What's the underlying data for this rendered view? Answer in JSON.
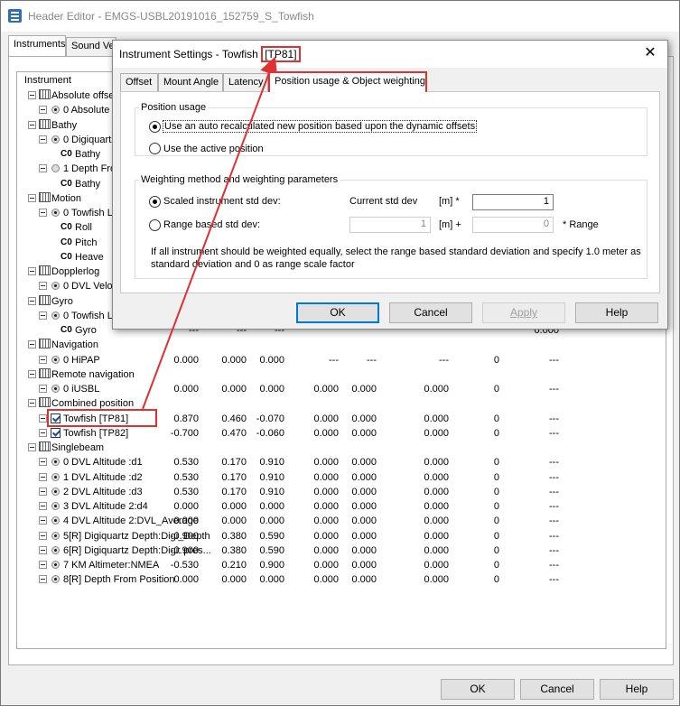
{
  "window": {
    "title": "Header Editor - EMGS-USBL20191016_152759_S_Towfish",
    "tabs": [
      "Instruments",
      "Sound Ve"
    ]
  },
  "tree": {
    "column_header": "Instrument",
    "rows": [
      {
        "label": "Absolute offse",
        "kind": "group"
      },
      {
        "label": "0 Absolute",
        "kind": "radio",
        "cells": []
      },
      {
        "label": "Bathy",
        "kind": "group"
      },
      {
        "label": "0 Digiquartz",
        "kind": "radio",
        "cells": []
      },
      {
        "label": "Bathy",
        "kind": "sensor"
      },
      {
        "label": "1 Depth Fro",
        "kind": "radio_off",
        "cells": []
      },
      {
        "label": "Bathy",
        "kind": "sensor"
      },
      {
        "label": "Motion",
        "kind": "group"
      },
      {
        "label": "0 Towfish Le",
        "kind": "radio",
        "cells": []
      },
      {
        "label": "Roll",
        "kind": "sensor"
      },
      {
        "label": "Pitch",
        "kind": "sensor"
      },
      {
        "label": "Heave",
        "kind": "sensor"
      },
      {
        "label": "Dopplerlog",
        "kind": "group"
      },
      {
        "label": "0 DVL Velo",
        "kind": "radio",
        "cells": []
      },
      {
        "label": "Gyro",
        "kind": "group"
      },
      {
        "label": "0 Towfish Le",
        "kind": "radio",
        "cells": []
      },
      {
        "label": "Gyro",
        "kind": "sensor",
        "cells": [
          "---",
          "---",
          "---",
          "",
          "",
          "",
          "",
          "0.000"
        ]
      },
      {
        "label": "Navigation",
        "kind": "group"
      },
      {
        "label": "0 HiPAP",
        "kind": "radio",
        "cells": [
          "0.000",
          "0.000",
          "0.000",
          "---",
          "---",
          "---",
          "0",
          "---"
        ]
      },
      {
        "label": "Remote navigation",
        "kind": "group"
      },
      {
        "label": "0 iUSBL",
        "kind": "radio",
        "cells": [
          "0.000",
          "0.000",
          "0.000",
          "0.000",
          "0.000",
          "0.000",
          "0",
          "---"
        ]
      },
      {
        "label": "Combined position",
        "kind": "group"
      },
      {
        "label": "Towfish [TP81]",
        "kind": "check",
        "cells": [
          "0.870",
          "0.460",
          "-0.070",
          "0.000",
          "0.000",
          "0.000",
          "0",
          "---"
        ]
      },
      {
        "label": "Towfish [TP82]",
        "kind": "check",
        "cells": [
          "-0.700",
          "0.470",
          "-0.060",
          "0.000",
          "0.000",
          "0.000",
          "0",
          "---"
        ]
      },
      {
        "label": "Singlebeam",
        "kind": "group"
      },
      {
        "label": "0 DVL Altitude :d1",
        "kind": "radio_g",
        "cells": [
          "0.530",
          "0.170",
          "0.910",
          "0.000",
          "0.000",
          "0.000",
          "0",
          "---"
        ]
      },
      {
        "label": "1 DVL Altitude :d2",
        "kind": "radio_g",
        "cells": [
          "0.530",
          "0.170",
          "0.910",
          "0.000",
          "0.000",
          "0.000",
          "0",
          "---"
        ]
      },
      {
        "label": "2 DVL Altitude :d3",
        "kind": "radio_g",
        "cells": [
          "0.530",
          "0.170",
          "0.910",
          "0.000",
          "0.000",
          "0.000",
          "0",
          "---"
        ]
      },
      {
        "label": "3 DVL Altitude 2:d4",
        "kind": "radio_g",
        "cells": [
          "0.000",
          "0.000",
          "0.000",
          "0.000",
          "0.000",
          "0.000",
          "0",
          "---"
        ]
      },
      {
        "label": "4 DVL Altitude 2:DVL_Average",
        "kind": "radio_g",
        "cells": [
          "0.000",
          "0.000",
          "0.000",
          "0.000",
          "0.000",
          "0.000",
          "0",
          "---"
        ]
      },
      {
        "label": "5[R] Digiquartz Depth:Digi_Depth",
        "kind": "radio_g",
        "cells": [
          "-0.900",
          "0.380",
          "0.590",
          "0.000",
          "0.000",
          "0.000",
          "0",
          "---"
        ]
      },
      {
        "label": "6[R] Digiquartz Depth:Digi: pres...",
        "kind": "radio_g",
        "cells": [
          "-0.900",
          "0.380",
          "0.590",
          "0.000",
          "0.000",
          "0.000",
          "0",
          "---"
        ]
      },
      {
        "label": "7 KM Altimeter:NMEA",
        "kind": "radio_g",
        "cells": [
          "-0.530",
          "0.210",
          "0.900",
          "0.000",
          "0.000",
          "0.000",
          "0",
          "---"
        ]
      },
      {
        "label": "8[R] Depth From Position",
        "kind": "radio_g",
        "cells": [
          "0.000",
          "0.000",
          "0.000",
          "0.000",
          "0.000",
          "0.000",
          "0",
          "---"
        ]
      }
    ]
  },
  "footer": {
    "ok": "OK",
    "cancel": "Cancel",
    "help": "Help"
  },
  "dialog": {
    "title": "Instrument Settings - Towfish ",
    "title_tag": "[TP81]",
    "close": "✕",
    "tabs": [
      "Offset",
      "Mount Angle",
      "Latency",
      "Position usage & Object weighting"
    ],
    "position_usage": {
      "caption": "Position usage",
      "opt_auto": "Use an auto recalculated new position based upon the dynamic offsets",
      "opt_active": "Use the active position"
    },
    "weighting": {
      "caption": "Weighting method and weighting parameters",
      "opt_scaled": "Scaled instrument std dev:",
      "current_std_label": "Current std dev",
      "unit_mult": "[m] *",
      "current_std_value": "1",
      "opt_range": "Range based std dev:",
      "range_std_value": "1",
      "unit_plus": "[m] +",
      "range_factor_value": "0",
      "range_suffix": "* Range",
      "note": "If all instrument should be weighted equally, select the range based standard deviation and specify 1.0 meter as standard deviation and 0 as range scale factor"
    },
    "buttons": {
      "ok": "OK",
      "cancel": "Cancel",
      "apply": "Apply",
      "help": "Help"
    }
  },
  "colors": {
    "annotation_red": "#e03030",
    "focus_blue": "#0078d7"
  }
}
